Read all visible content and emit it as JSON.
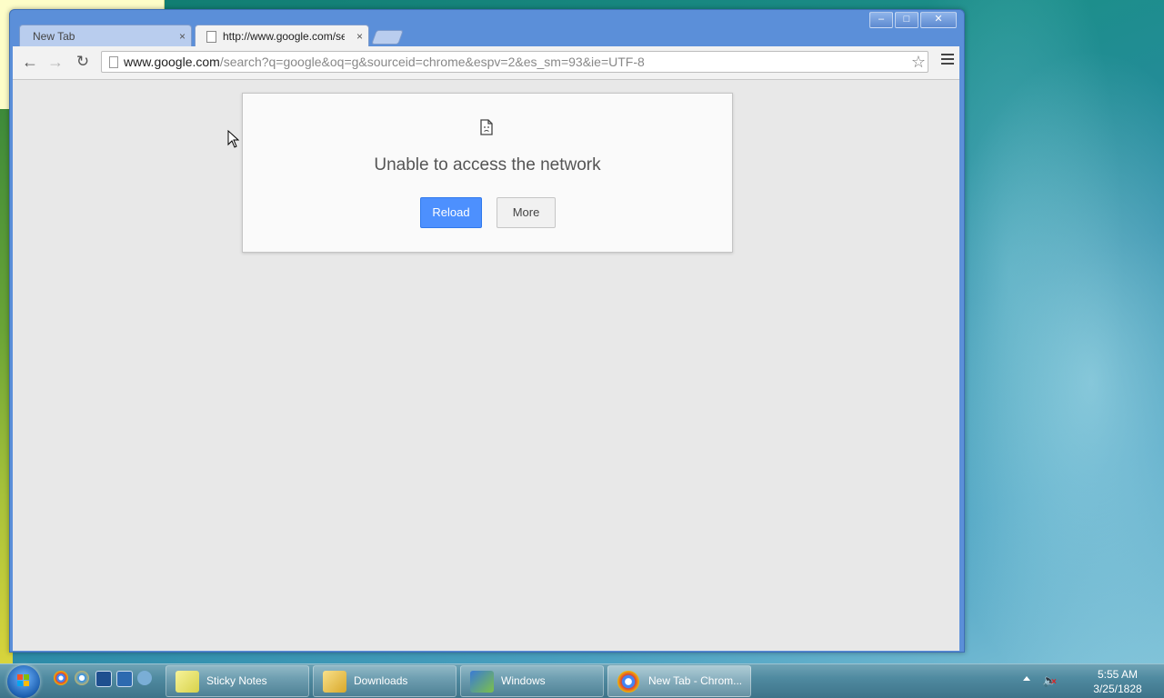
{
  "browser": {
    "tabs": [
      {
        "title": "New Tab",
        "close": "×"
      },
      {
        "title": "http://www.google.com/search?q=google&oq=g",
        "close": "×"
      }
    ],
    "window_controls": {
      "minimize": "–",
      "maximize": "□",
      "close": "✕"
    },
    "address": {
      "host": "www.google.com",
      "path": "/search?q=google&oq=g&sourceid=chrome&espv=2&es_sm=93&ie=UTF-8"
    },
    "nav": {
      "back": "←",
      "forward": "→",
      "reload": "↻",
      "star": "☆"
    }
  },
  "error": {
    "title": "Unable to access the network",
    "reload_label": "Reload",
    "more_label": "More"
  },
  "taskbar": {
    "tasks": [
      {
        "label": "Sticky Notes"
      },
      {
        "label": "Downloads"
      },
      {
        "label": "Windows"
      },
      {
        "label": "New Tab - Chrom..."
      }
    ],
    "clock": {
      "time": "5:55 AM",
      "date": "3/25/1828"
    }
  },
  "colors": {
    "accent_blue": "#4d90fe",
    "window_frame": "#5b8fd9",
    "content_bg": "#e8e8e8"
  }
}
